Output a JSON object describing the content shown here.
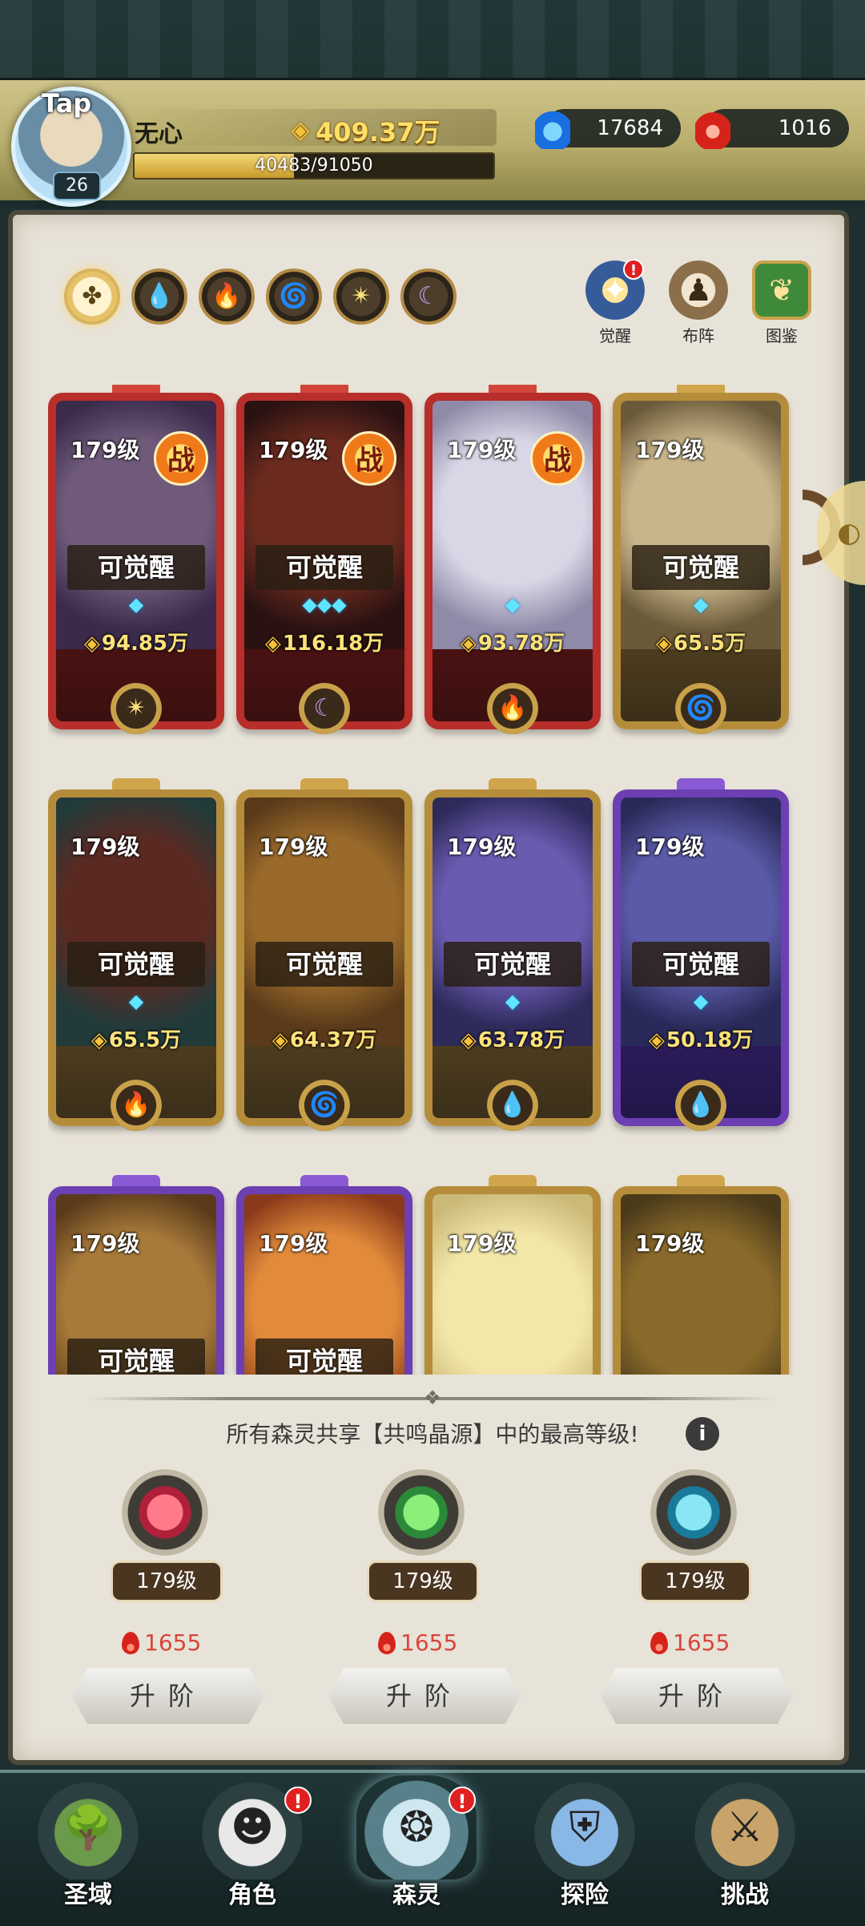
{
  "player": {
    "avatar_tag": "Tap",
    "name": "无心",
    "level": "26",
    "gold": "409.37万",
    "exp_text": "40483/91050",
    "exp_fraction": 0.4446
  },
  "resources": {
    "crystal": "17684",
    "ruby": "1016"
  },
  "tabs": [
    {
      "name": "all",
      "icon": "clover-icon",
      "glyph": "✤",
      "cls": "ic-all"
    },
    {
      "name": "water",
      "icon": "water-drop-icon",
      "glyph": "💧",
      "cls": "ic-water"
    },
    {
      "name": "fire",
      "icon": "flame-icon",
      "glyph": "🔥",
      "cls": "ic-fire"
    },
    {
      "name": "wind",
      "icon": "wind-icon",
      "glyph": "🌀",
      "cls": "ic-wind"
    },
    {
      "name": "light",
      "icon": "star-icon",
      "glyph": "✴",
      "cls": "ic-light"
    },
    {
      "name": "dark",
      "icon": "moon-icon",
      "glyph": "☾",
      "cls": "ic-dark"
    }
  ],
  "shortcuts": {
    "awaken": "觉醒",
    "formation": "布阵",
    "codex": "图鉴",
    "awaken_badge": "!"
  },
  "cards": [
    {
      "color": "red",
      "level": "179级",
      "battle": "战",
      "awaken": "可觉醒",
      "stars": "◆",
      "power": "94.85万",
      "element": "light",
      "glyph": "✴",
      "portrait": [
        "#6f5a7a",
        "#3b2a4a"
      ]
    },
    {
      "color": "red",
      "level": "179级",
      "battle": "战",
      "awaken": "可觉醒",
      "stars": "◆◆◆",
      "power": "116.18万",
      "element": "dark",
      "glyph": "☾",
      "portrait": [
        "#6a2a1e",
        "#2a1212"
      ]
    },
    {
      "color": "red",
      "level": "179级",
      "battle": "战",
      "awaken": "",
      "stars": "◆",
      "power": "93.78万",
      "element": "fire",
      "glyph": "🔥",
      "portrait": [
        "#d9d7e6",
        "#8e8aa8"
      ]
    },
    {
      "color": "gold",
      "level": "179级",
      "battle": "",
      "awaken": "可觉醒",
      "stars": "◆",
      "power": "65.5万",
      "element": "wind",
      "glyph": "🌀",
      "portrait": [
        "#c9b58a",
        "#6b5a3a"
      ]
    },
    {
      "color": "gold",
      "level": "179级",
      "battle": "",
      "awaken": "可觉醒",
      "stars": "◆",
      "power": "65.5万",
      "element": "fire",
      "glyph": "🔥",
      "portrait": [
        "#5a2a22",
        "#233a3a"
      ]
    },
    {
      "color": "gold",
      "level": "179级",
      "battle": "",
      "awaken": "可觉醒",
      "stars": "",
      "power": "64.37万",
      "element": "wind",
      "glyph": "🌀",
      "portrait": [
        "#9a6a2a",
        "#5a3a1a"
      ]
    },
    {
      "color": "gold",
      "level": "179级",
      "battle": "",
      "awaken": "可觉醒",
      "stars": "◆",
      "power": "63.78万",
      "element": "water",
      "glyph": "💧",
      "portrait": [
        "#6a5ab0",
        "#2e2a5a"
      ]
    },
    {
      "color": "purple",
      "level": "179级",
      "battle": "",
      "awaken": "可觉醒",
      "stars": "◆",
      "power": "50.18万",
      "element": "water",
      "glyph": "💧",
      "portrait": [
        "#5a5aa8",
        "#2a2a5a"
      ]
    },
    {
      "color": "purple",
      "level": "179级",
      "battle": "",
      "awaken": "可觉醒",
      "stars": "",
      "power": "",
      "element": "",
      "glyph": "",
      "portrait": [
        "#a87a3a",
        "#5a3a1a"
      ]
    },
    {
      "color": "purple",
      "level": "179级",
      "battle": "",
      "awaken": "可觉醒",
      "stars": "",
      "power": "",
      "element": "",
      "glyph": "",
      "portrait": [
        "#e08a3a",
        "#8a3a1a"
      ]
    },
    {
      "color": "gold",
      "level": "179级",
      "battle": "",
      "awaken": "",
      "stars": "",
      "power": "",
      "element": "",
      "glyph": "",
      "portrait": [
        "#f2e6a8",
        "#cbb978"
      ]
    },
    {
      "color": "gold",
      "level": "179级",
      "battle": "",
      "awaken": "",
      "stars": "",
      "power": "",
      "element": "",
      "glyph": "",
      "portrait": [
        "#8a6a2a",
        "#4a3a1a"
      ]
    }
  ],
  "resonance": {
    "hint": "所有森灵共享【共鸣晶源】中的最高等级!",
    "info": "i",
    "orbs": [
      {
        "level": "179级",
        "cost": "1655",
        "button": "升阶",
        "c1": "#ff7a8a",
        "c2": "#b0203a"
      },
      {
        "level": "179级",
        "cost": "1655",
        "button": "升阶",
        "c1": "#8af07a",
        "c2": "#2a8a3a"
      },
      {
        "level": "179级",
        "cost": "1655",
        "button": "升阶",
        "c1": "#8ae6f5",
        "c2": "#1a7a9a"
      }
    ]
  },
  "nav": [
    {
      "label": "圣域",
      "icon": "tree-icon",
      "glyph": "🌳",
      "c1": "#6a9a4a",
      "badge": ""
    },
    {
      "label": "角色",
      "icon": "character-icon",
      "glyph": "☻",
      "c1": "#e8e8e8",
      "badge": "!"
    },
    {
      "label": "森灵",
      "icon": "spirit-icon",
      "glyph": "❂",
      "c1": "#cfe7ee",
      "badge": "!"
    },
    {
      "label": "探险",
      "icon": "shield-icon",
      "glyph": "⛨",
      "c1": "#8ab8e6",
      "badge": ""
    },
    {
      "label": "挑战",
      "icon": "sword-icon",
      "glyph": "⚔",
      "c1": "#c9a46a",
      "badge": ""
    }
  ],
  "colors": {
    "accent_gold": "#f7c33a",
    "badge_red": "#e02020",
    "cost_red": "#d9453a"
  }
}
